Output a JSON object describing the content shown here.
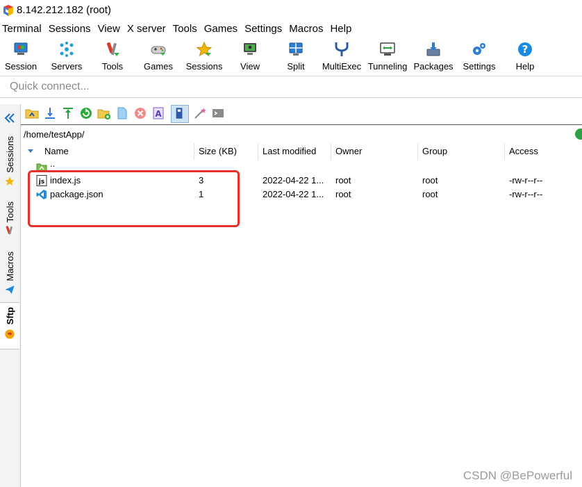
{
  "window": {
    "title": "8.142.212.182 (root)"
  },
  "menu": [
    "Terminal",
    "Sessions",
    "View",
    "X server",
    "Tools",
    "Games",
    "Settings",
    "Macros",
    "Help"
  ],
  "toolbar": [
    {
      "label": "Session",
      "icon": "session-icon"
    },
    {
      "label": "Servers",
      "icon": "servers-icon"
    },
    {
      "label": "Tools",
      "icon": "tools-icon"
    },
    {
      "label": "Games",
      "icon": "gamepad-icon"
    },
    {
      "label": "Sessions",
      "icon": "star-icon"
    },
    {
      "label": "View",
      "icon": "view-icon"
    },
    {
      "label": "Split",
      "icon": "split-icon"
    },
    {
      "label": "MultiExec",
      "icon": "multiexec-icon"
    },
    {
      "label": "Tunneling",
      "icon": "tunneling-icon"
    },
    {
      "label": "Packages",
      "icon": "packages-icon"
    },
    {
      "label": "Settings",
      "icon": "gears-icon"
    },
    {
      "label": "Help",
      "icon": "help-icon"
    }
  ],
  "quick_connect": {
    "placeholder": "Quick connect..."
  },
  "sidebar": {
    "tabs": [
      {
        "label": "Sessions",
        "icon": "star-icon"
      },
      {
        "label": "Tools",
        "icon": "tools-icon"
      },
      {
        "label": "Macros",
        "icon": "paper-plane-icon"
      },
      {
        "label": "Sftp",
        "icon": "sftp-icon"
      }
    ],
    "active_tab": "Sftp"
  },
  "sftp": {
    "path": "/home/testApp/",
    "columns": [
      "Name",
      "Size (KB)",
      "Last modified",
      "Owner",
      "Group",
      "Access"
    ],
    "parent_dir": "..",
    "files": [
      {
        "name": "index.js",
        "size": "3",
        "modified": "2022-04-22 1...",
        "owner": "root",
        "group": "root",
        "access": "-rw-r--r--",
        "icon": "js-file-icon"
      },
      {
        "name": "package.json",
        "size": "1",
        "modified": "2022-04-22 1...",
        "owner": "root",
        "group": "root",
        "access": "-rw-r--r--",
        "icon": "vscode-file-icon"
      }
    ]
  },
  "watermark": "CSDN @BePowerful",
  "colors": {
    "highlight": "#e5312b",
    "accent": "#1a6fd0"
  }
}
